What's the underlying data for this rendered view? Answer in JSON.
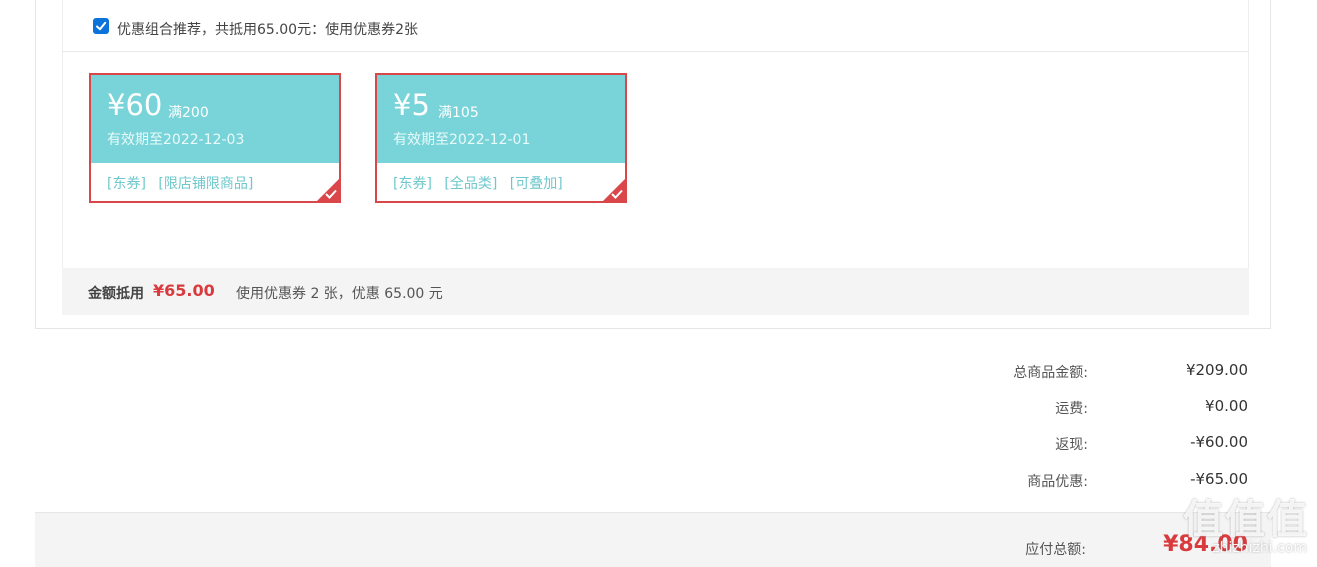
{
  "combo": {
    "checked": true,
    "text": "优惠组合推荐，共抵用65.00元：使用优惠券2张"
  },
  "coupons": [
    {
      "amount": "¥60",
      "condition": "满200",
      "expiry": "有效期至2022-12-03",
      "tags": [
        "[东券]",
        "[限店铺限商品]"
      ],
      "selected": true
    },
    {
      "amount": "¥5",
      "condition": "满105",
      "expiry": "有效期至2022-12-01",
      "tags": [
        "[东券]",
        "[全品类]",
        "[可叠加]"
      ],
      "selected": true
    }
  ],
  "summary": {
    "label": "金额抵用",
    "value": "¥65.00",
    "desc": "使用优惠券 2 张，优惠 65.00 元"
  },
  "totals": [
    {
      "label": "总商品金额:",
      "value": "¥209.00"
    },
    {
      "label": "运费:",
      "value": "¥0.00"
    },
    {
      "label": "返现:",
      "value": "-¥60.00"
    },
    {
      "label": "商品优惠:",
      "value": "-¥65.00"
    }
  ],
  "payable": {
    "label": "应付总额:",
    "value": "¥84.00"
  },
  "watermark": {
    "logo": "值值值",
    "site": "zhizhizhi.com"
  },
  "colors": {
    "accent_red": "#d9474a",
    "coupon_teal": "#78d4d8",
    "price_red": "#d93a3e",
    "checkbox_blue": "#0a74da"
  }
}
